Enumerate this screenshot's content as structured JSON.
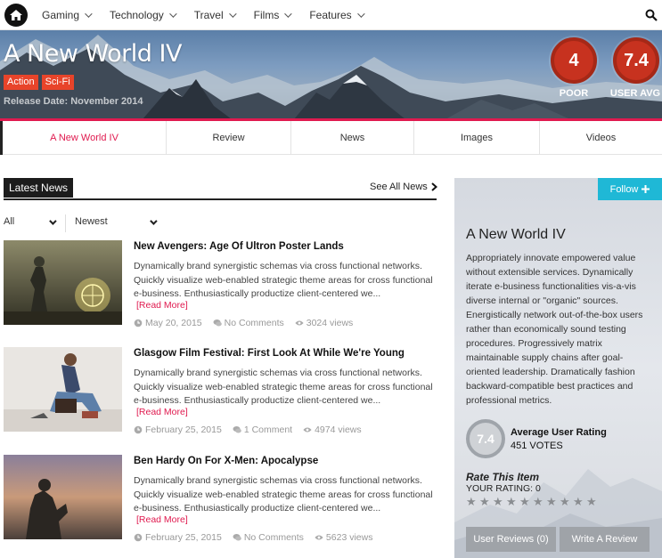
{
  "nav": {
    "items": [
      {
        "label": "Gaming"
      },
      {
        "label": "Technology"
      },
      {
        "label": "Travel"
      },
      {
        "label": "Films"
      },
      {
        "label": "Features"
      }
    ]
  },
  "hero": {
    "title": "A New World IV",
    "tags": [
      "Action",
      "Sci-Fi"
    ],
    "release": "Release Date: November 2014",
    "scores": [
      {
        "value": "4",
        "label": "POOR"
      },
      {
        "value": "7.4",
        "label": "USER AVG"
      }
    ]
  },
  "tabs": [
    {
      "label": "A New World IV"
    },
    {
      "label": "Review"
    },
    {
      "label": "News"
    },
    {
      "label": "Images"
    },
    {
      "label": "Videos"
    }
  ],
  "news": {
    "heading": "Latest News",
    "see_all": "See All News",
    "filter_all": "All",
    "filter_sort": "Newest",
    "articles": [
      {
        "title": "New Avengers: Age Of Ultron Poster Lands",
        "text": "Dynamically brand synergistic schemas via cross functional networks. Quickly visualize web-enabled strategic theme areas for cross functional e-business. Enthusiastically productize client-centered we...",
        "read_more": "[Read More]",
        "date": "May 20, 2015",
        "comments": "No Comments",
        "views": "3024 views"
      },
      {
        "title": "Glasgow Film Festival: First Look At While We're Young",
        "text": "Dynamically brand synergistic schemas via cross functional networks. Quickly visualize web-enabled strategic theme areas for cross functional e-business. Enthusiastically productize client-centered we...",
        "read_more": "[Read More]",
        "date": "February 25, 2015",
        "comments": "1 Comment",
        "views": "4974 views"
      },
      {
        "title": "Ben Hardy On For X-Men: Apocalypse",
        "text": "Dynamically brand synergistic schemas via cross functional networks. Quickly visualize web-enabled strategic theme areas for cross functional e-business. Enthusiastically productize client-centered we...",
        "read_more": "[Read More]",
        "date": "February 25, 2015",
        "comments": "No Comments",
        "views": "5623 views"
      }
    ]
  },
  "sidebar": {
    "follow": "Follow",
    "title": "A New World IV",
    "description": "Appropriately innovate empowered value without extensible services. Dynamically iterate e-business functionalities vis-a-vis diverse internal or \"organic\" sources. Energistically network out-of-the-box users rather than economically sound testing procedures. Progressively matrix maintainable supply chains after goal-oriented leadership. Dramatically fashion backward-compatible best practices and professional metrics.",
    "avg_value": "7.4",
    "avg_label": "Average User Rating",
    "votes": "451 VOTES",
    "rate_title": "Rate This Item",
    "your_rating": "YOUR RATING: 0",
    "star_count": 10,
    "user_reviews": "User Reviews (0)",
    "write_review": "Write A Review"
  },
  "colors": {
    "accent": "#e01a4f",
    "tag": "#e8442a",
    "score": "#c7321f",
    "follow": "#1fb8d6"
  }
}
